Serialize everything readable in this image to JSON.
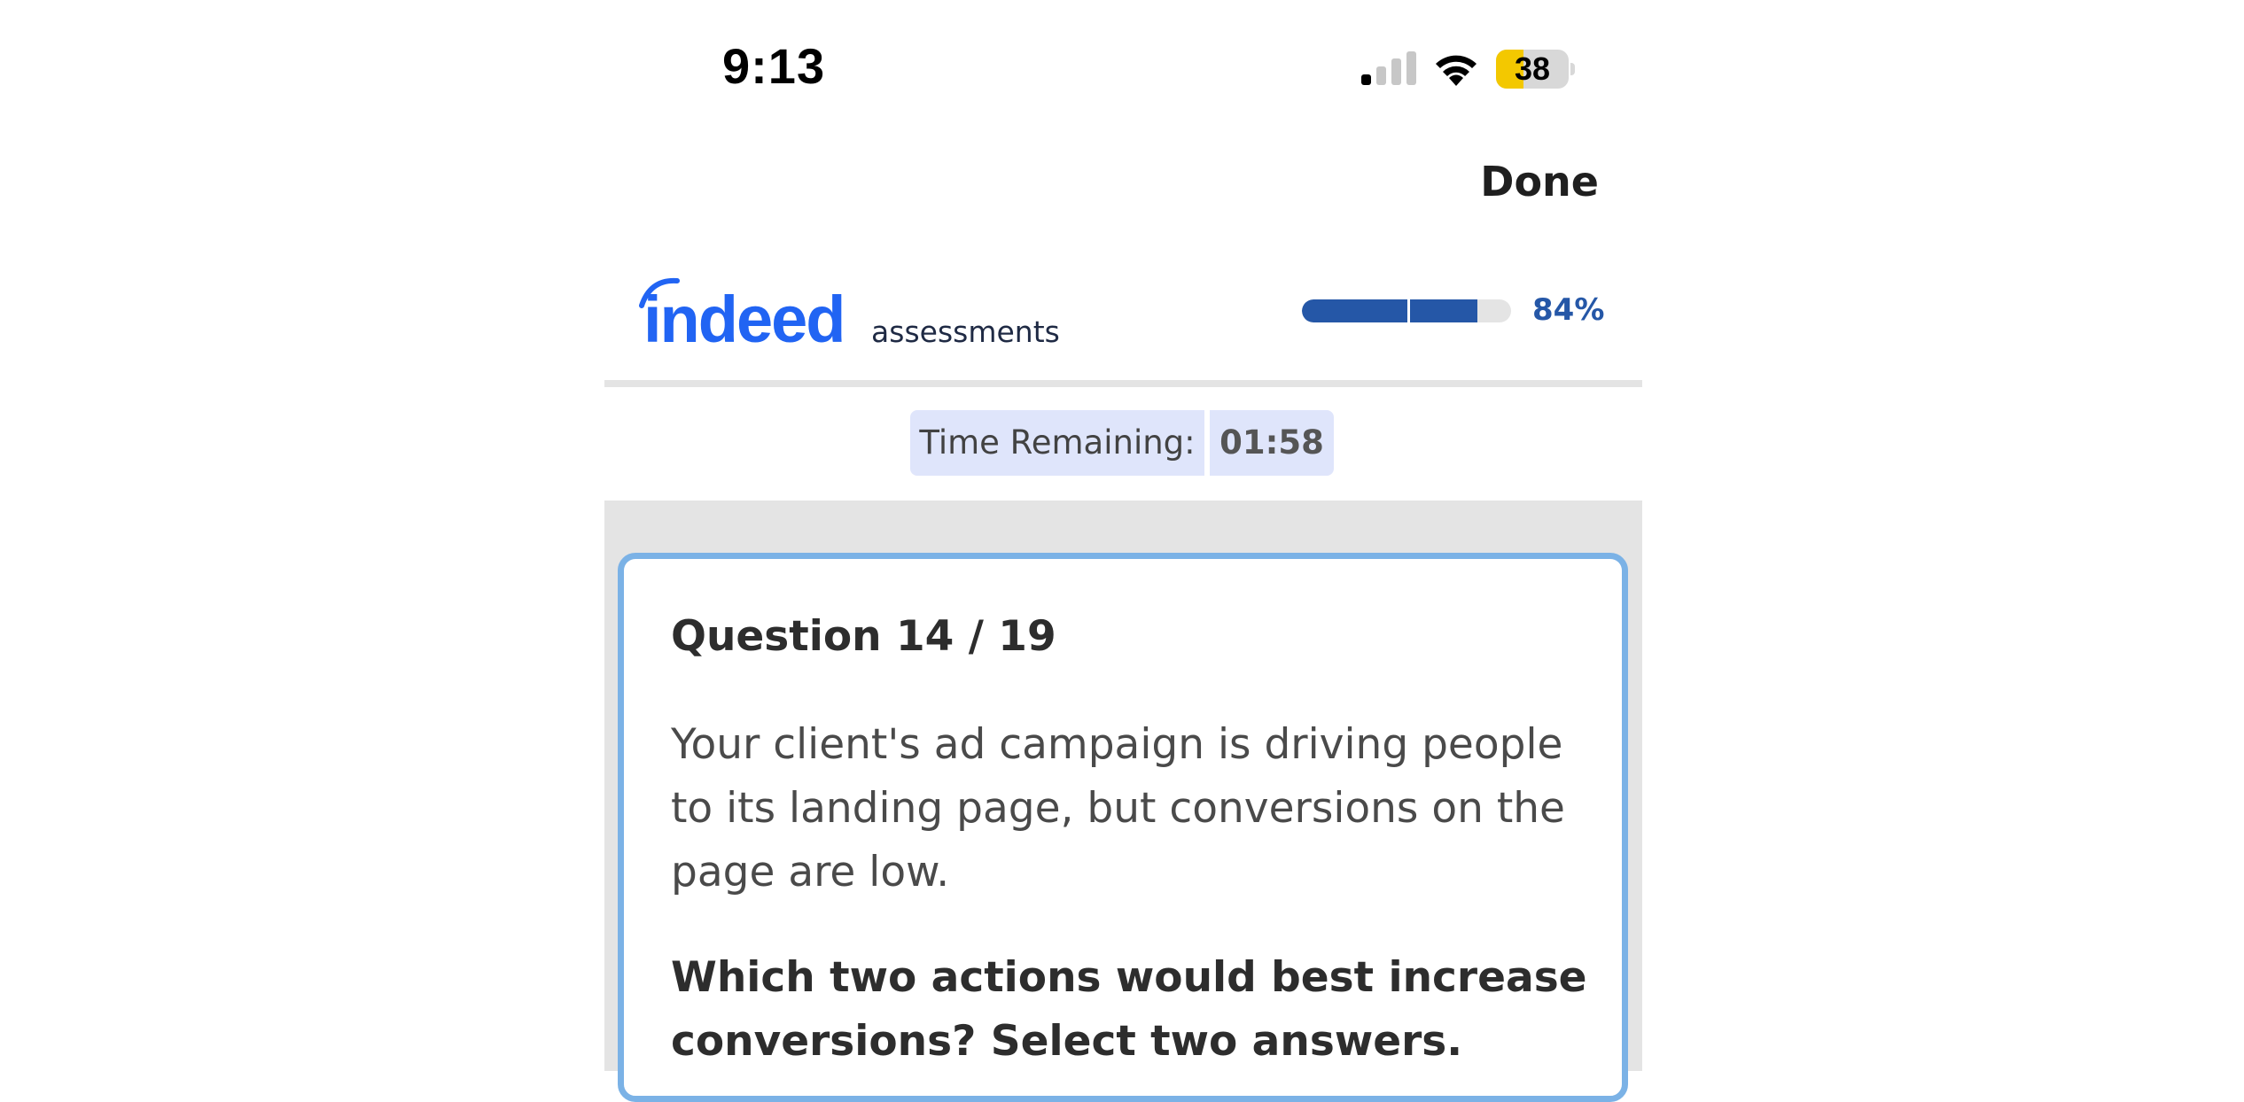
{
  "status_bar": {
    "time": "9:13",
    "battery": "38",
    "battery_level": 0.38,
    "signal_bars_active": 1,
    "signal_bars_total": 4,
    "icons": [
      "cellular-signal-icon",
      "wifi-icon",
      "battery-icon"
    ]
  },
  "nav": {
    "done_label": "Done"
  },
  "header": {
    "logo_word": "indeed",
    "logo_sub": "assessments",
    "progress_value": 84,
    "progress_label": "84%",
    "colors": {
      "brand": "#2164f3",
      "progress": "#2557a7"
    }
  },
  "timer": {
    "label": "Time Remaining:",
    "value": "01:58"
  },
  "question": {
    "counter": "Question 14 / 19",
    "text": "Your client's ad campaign is driving people to its landing page, but conversions on the page are low.",
    "prompt": "Which two actions would best increase conversions? Select two answers.",
    "card_border_color": "#7bb2e6"
  }
}
